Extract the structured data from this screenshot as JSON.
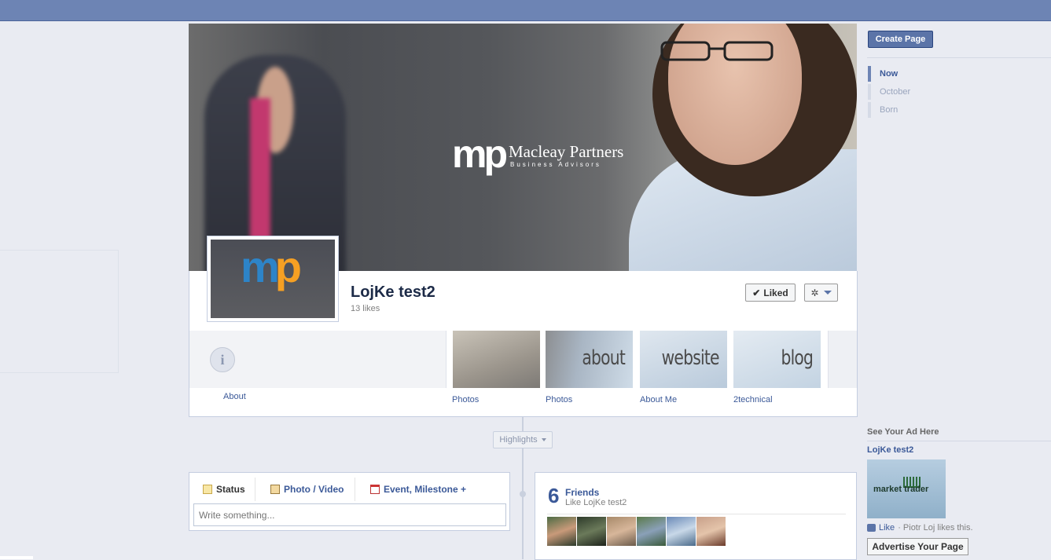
{
  "cover": {
    "brand_name": "Macleay Partners",
    "brand_tagline": "Business Advisors",
    "brand_mark": "mp"
  },
  "profile": {
    "logo_mark_m": "m",
    "logo_mark_p": "p"
  },
  "page": {
    "name": "LojKe test2",
    "likes": "13 likes"
  },
  "actions": {
    "liked_label": "Liked",
    "gear_icon": "gear-icon"
  },
  "apps": [
    {
      "label": "About",
      "icon": "info-icon"
    },
    {
      "label": "Photos",
      "thumb_text": ""
    },
    {
      "label": "Photos",
      "thumb_text": "about"
    },
    {
      "label": "About Me",
      "thumb_text": "website"
    },
    {
      "label": "2technical",
      "thumb_text": "blog"
    }
  ],
  "timeline": {
    "highlights_label": "Highlights"
  },
  "composer": {
    "tabs": [
      {
        "label": "Status"
      },
      {
        "label": "Photo / Video"
      },
      {
        "label": "Event, Milestone +"
      }
    ],
    "placeholder": "Write something..."
  },
  "friends": {
    "count": "6",
    "title": "Friends",
    "subtitle": "Like LojKe test2"
  },
  "sidebar": {
    "create_page": "Create Page",
    "timeline_nav": [
      {
        "label": "Now"
      },
      {
        "label": "October"
      },
      {
        "label": "Born"
      }
    ],
    "ad": {
      "heading": "See Your Ad Here",
      "title": "LojKe test2",
      "image_text": "market trader",
      "like_label": "Like",
      "like_text": "· Piotr Loj likes this.",
      "advertise_label": "Advertise Your Page"
    }
  },
  "colors": {
    "topbar": "#6d84b4",
    "link": "#3b5998",
    "background": "#e9ebf2"
  }
}
